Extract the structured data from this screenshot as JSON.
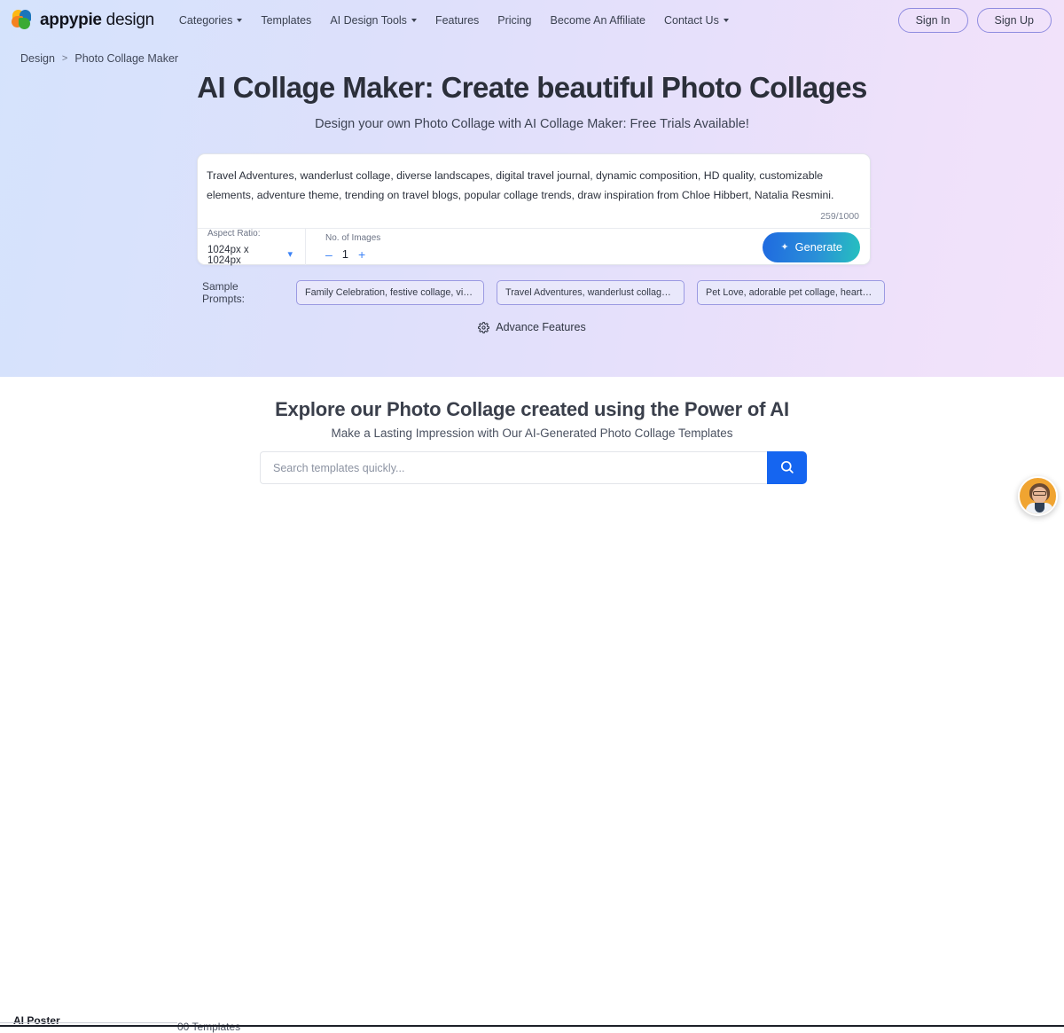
{
  "header": {
    "logo": {
      "brand": "appypie",
      "product": " design"
    },
    "nav": [
      {
        "label": "Categories",
        "has_caret": true
      },
      {
        "label": "Templates",
        "has_caret": false
      },
      {
        "label": "AI Design Tools",
        "has_caret": true
      },
      {
        "label": "Features",
        "has_caret": false
      },
      {
        "label": "Pricing",
        "has_caret": false
      },
      {
        "label": "Become An Affiliate",
        "has_caret": false
      },
      {
        "label": "Contact Us",
        "has_caret": true
      }
    ],
    "sign_in": "Sign In",
    "sign_up": "Sign Up"
  },
  "breadcrumb": {
    "root": "Design",
    "separator": ">",
    "current": "Photo Collage Maker"
  },
  "hero": {
    "title": "AI Collage Maker: Create beautiful Photo Collages",
    "subtitle": "Design your own Photo Collage with AI Collage Maker: Free Trials Available!"
  },
  "prompt_card": {
    "prompt_value": "Travel Adventures, wanderlust collage, diverse landscapes, digital travel journal, dynamic composition, HD quality, customizable elements, adventure theme, trending on travel blogs, popular collage trends, draw inspiration from Chloe Hibbert, Natalia Resmini.",
    "char_count": "259/1000",
    "aspect_ratio_label": "Aspect Ratio:",
    "aspect_ratio_value": "1024px x 1024px",
    "num_images_label": "No. of Images",
    "num_images_value": "1",
    "decrement": "–",
    "increment": "+",
    "generate_label": "Generate",
    "generate_icon": "sparkle-icon"
  },
  "sample_prompts": {
    "label": "Sample Prompts:",
    "chips": [
      "Family Celebration, festive collage, vibrant col...",
      "Travel Adventures, wanderlust collage, diverse...",
      "Pet Love, adorable pet collage, heartwarming ..."
    ]
  },
  "advance_features": {
    "label": "Advance Features",
    "icon": "gear-icon"
  },
  "explore": {
    "title": "Explore our Photo Collage created using the Power of AI",
    "subtitle": "Make a Lasting Impression with Our AI-Generated Photo Collage Templates",
    "search_placeholder": "Search templates quickly...",
    "search_value": "",
    "search_icon": "search-icon"
  },
  "bottom_strip": {
    "label": "AI Poster",
    "count": "00 Templates"
  },
  "chat_widget": {
    "icon": "agent-avatar"
  },
  "colors": {
    "hero_gradient_start": "#d5e3fc",
    "hero_gradient_end": "#f2e3fa",
    "accent_blue": "#1565f0",
    "generate_gradient_start": "#1f6ae0",
    "generate_gradient_end": "#26c0bf",
    "chip_border": "#9b9ae2",
    "chip_fill": "#e9e8fb",
    "avatar_bg": "#f0a431"
  }
}
